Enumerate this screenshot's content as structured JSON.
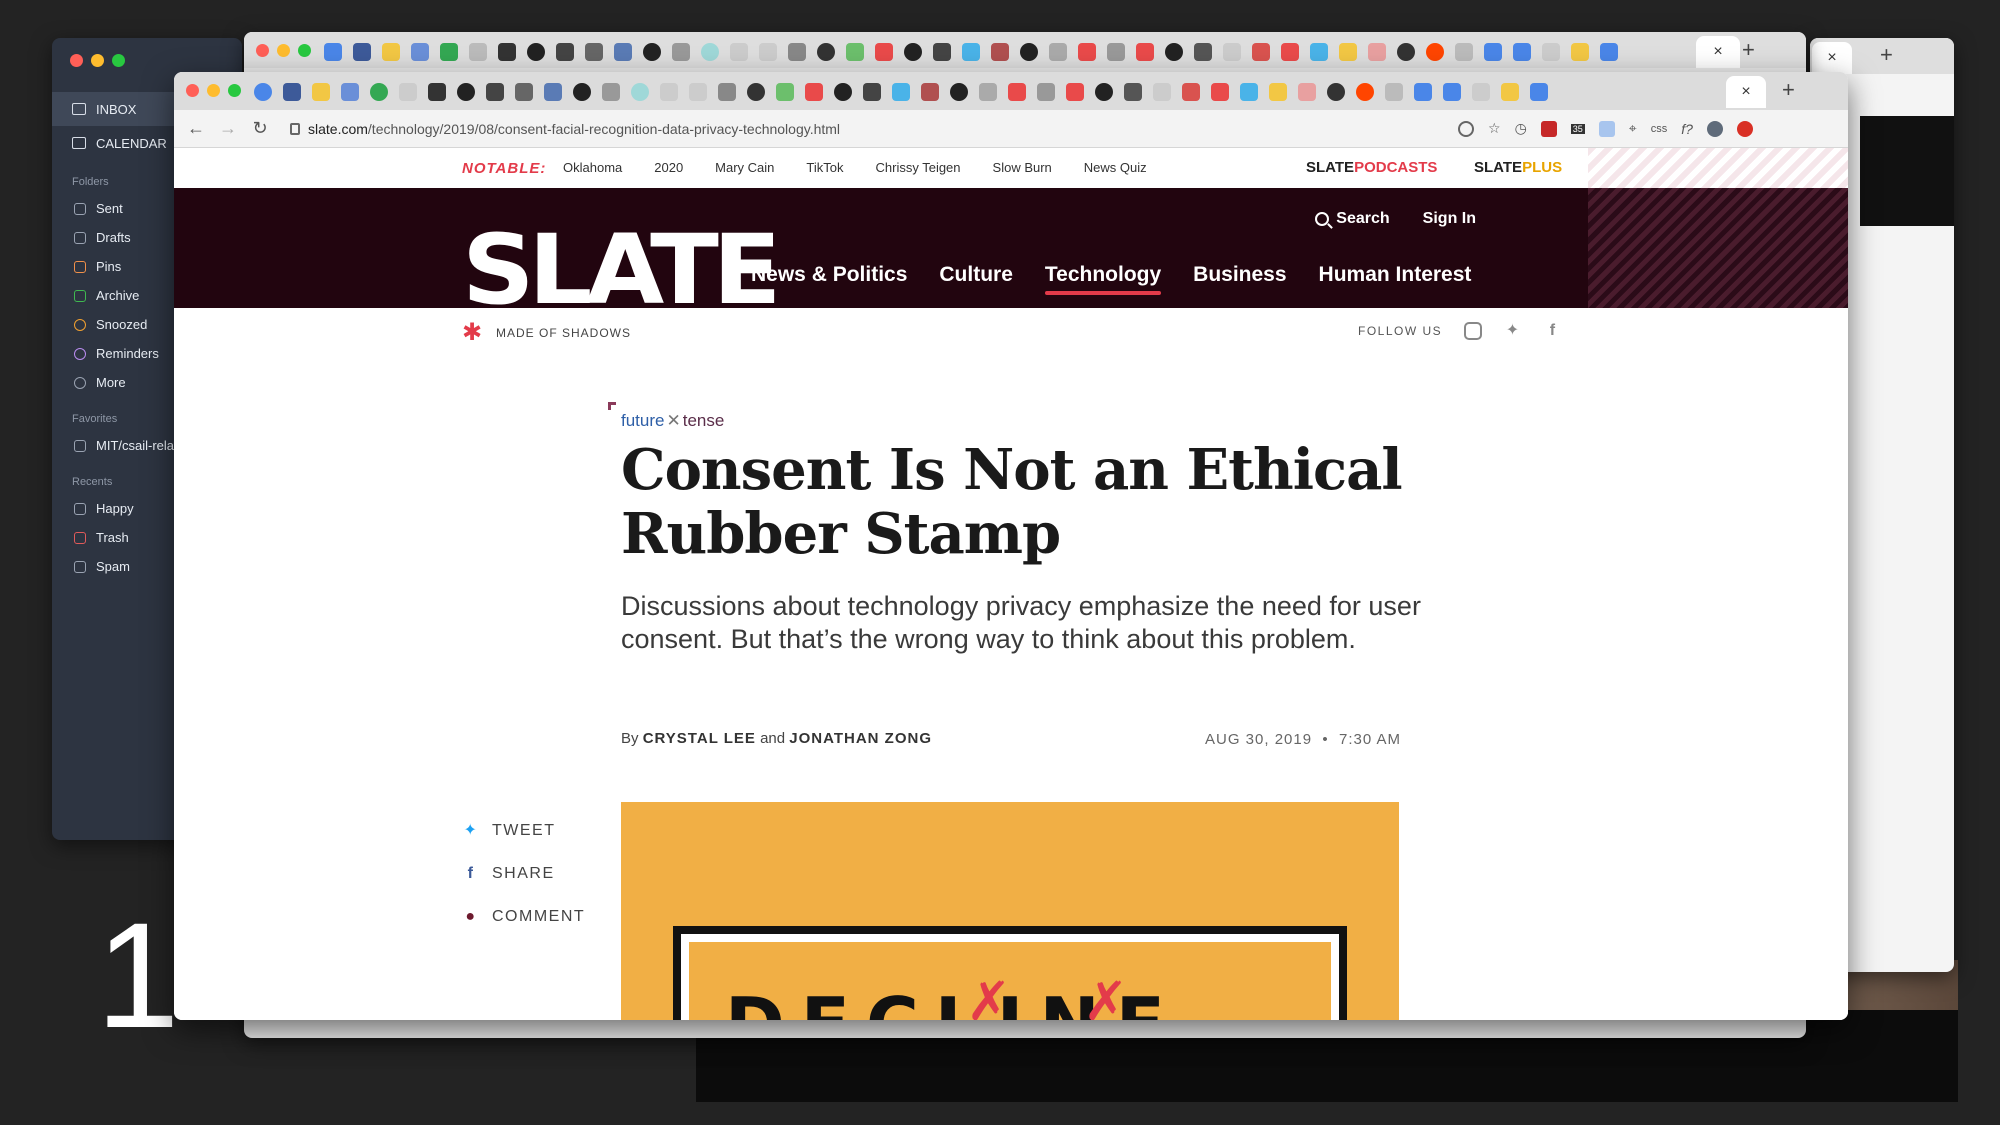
{
  "overlay": {
    "number": "1"
  },
  "mail": {
    "primary": [
      {
        "label": "INBOX",
        "icon": "inbox-icon"
      },
      {
        "label": "CALENDAR",
        "icon": "calendar-icon"
      }
    ],
    "folders_title": "Folders",
    "folders": [
      {
        "label": "Sent",
        "icon": "sent-icon"
      },
      {
        "label": "Drafts",
        "icon": "drafts-icon"
      },
      {
        "label": "Pins",
        "icon": "pin-icon",
        "color": "#f0904a"
      },
      {
        "label": "Archive",
        "icon": "archive-icon",
        "color": "#3fb950"
      },
      {
        "label": "Snoozed",
        "icon": "clock-icon",
        "color": "#f0a030"
      },
      {
        "label": "Reminders",
        "icon": "reminder-icon",
        "color": "#b98cf0"
      },
      {
        "label": "More",
        "icon": "more-icon"
      }
    ],
    "favorites_title": "Favorites",
    "favorites": [
      {
        "label": "MIT/csail-rela",
        "icon": "folder-icon"
      }
    ],
    "recents_title": "Recents",
    "recents": [
      {
        "label": "Happy",
        "icon": "folder-icon"
      },
      {
        "label": "Trash",
        "icon": "trash-icon",
        "color": "#e05a5a"
      },
      {
        "label": "Spam",
        "icon": "spam-icon"
      }
    ]
  },
  "browser": {
    "url_host": "slate.com",
    "url_path": "/technology/2019/08/consent-facial-recognition-data-privacy-technology.html",
    "tab_close": "×",
    "new_tab": "+",
    "ext_badge": "35",
    "ext_css": "css",
    "ext_fq": "f?"
  },
  "slate": {
    "notable_label": "NOTABLE:",
    "notable_links": [
      "Oklahoma",
      "2020",
      "Mary Cain",
      "TikTok",
      "Chrissy Teigen",
      "Slow Burn",
      "News Quiz"
    ],
    "podcasts_a": "SLATE",
    "podcasts_b": "PODCASTS",
    "plus_a": "SLATE",
    "plus_b": "PLUS",
    "logo": "SLATE",
    "nav": [
      "News & Politics",
      "Culture",
      "Technology",
      "Business",
      "Human Interest"
    ],
    "active_nav": "Technology",
    "search": "Search",
    "sign_in": "Sign In",
    "sponsor": "MADE OF SHADOWS",
    "follow_us": "FOLLOW US",
    "section_a": "future",
    "section_b": "tense",
    "headline": "Consent Is Not an Ethical Rubber Stamp",
    "dek": "Discussions about technology privacy emphasize the need for user consent. But that’s the wrong way to think about this problem.",
    "by": "By",
    "author1": "CRYSTAL LEE",
    "and": "and",
    "author2": "JONATHAN ZONG",
    "date": "AUG 30, 2019",
    "time": "7:30 AM",
    "share": [
      "TWEET",
      "SHARE",
      "COMMENT"
    ],
    "hero_text": "DECLINE",
    "colors": {
      "brand_dark": "#22050f",
      "accent": "#e33b4a",
      "hero": "#f1af45"
    }
  }
}
